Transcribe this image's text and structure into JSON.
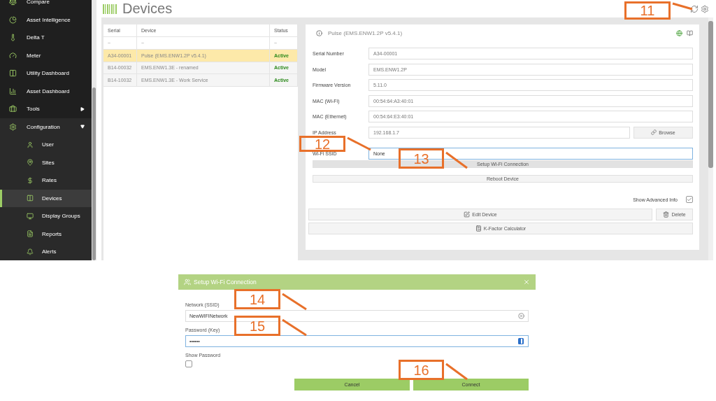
{
  "sidebar": {
    "items": [
      {
        "label": "Compare",
        "selected": false
      },
      {
        "label": "Asset Intelligence",
        "selected": false
      },
      {
        "label": "Delta T",
        "selected": false
      },
      {
        "label": "Meter",
        "selected": false
      },
      {
        "label": "Utility Dashboard",
        "selected": false
      },
      {
        "label": "Asset Dashboard",
        "selected": false
      },
      {
        "label": "Tools",
        "selected": false,
        "expanded": false
      },
      {
        "label": "Configuration",
        "selected": false,
        "expanded": true,
        "children": [
          {
            "label": "User",
            "selected": false
          },
          {
            "label": "Sites",
            "selected": false
          },
          {
            "label": "Rates",
            "selected": false
          },
          {
            "label": "Devices",
            "selected": true
          },
          {
            "label": "Display Groups",
            "selected": false
          },
          {
            "label": "Reports",
            "selected": false
          },
          {
            "label": "Alerts",
            "selected": false
          }
        ]
      }
    ]
  },
  "page": {
    "title": "Devices"
  },
  "table": {
    "columns": [
      "Serial",
      "Device",
      "Status"
    ],
    "filters": [
      "~",
      "~",
      "~"
    ],
    "rows": [
      {
        "serial": "A34-00001",
        "device": "Pulse (EMS.ENW1.2P v5.4.1)",
        "status": "Active",
        "selected": true
      },
      {
        "serial": "B14-00032",
        "device": "EMS.ENW1.3E - renamed",
        "status": "Active",
        "selected": false
      },
      {
        "serial": "B14-10032",
        "device": "EMS.ENW1.3E - Work Service",
        "status": "Active",
        "selected": false
      }
    ]
  },
  "detail": {
    "title": "Pulse (EMS.ENW1.2P v5.4.1)",
    "fields": [
      {
        "label": "Serial Number",
        "value": "A34-00001"
      },
      {
        "label": "Model",
        "value": "EMS.ENW1.2P"
      },
      {
        "label": "Firmware Version",
        "value": "5.11.0"
      },
      {
        "label": "MAC (Wi-Fi)",
        "value": "00:54:64:A3:40:01"
      },
      {
        "label": "MAC (Ethernet)",
        "value": "00:54:64:E3:40:01"
      },
      {
        "label": "IP Address",
        "value": "192.168.1.7",
        "button": "Browse"
      },
      {
        "label": "Wi-Fi SSID",
        "value": "None",
        "focused": true
      }
    ],
    "setup_button": "Setup Wi-Fi Connection",
    "reboot_button": "Reboot Device",
    "advanced": {
      "label": "Show Advanced Info",
      "checked": true
    },
    "edit_button": "Edit Device",
    "delete_button": "Delete",
    "kfactor_button": "K-Factor Calculator"
  },
  "dialog": {
    "title": "Setup Wi-Fi Connection",
    "network": {
      "label": "Network (SSID)",
      "value": "NewWIFINetwork"
    },
    "password": {
      "label": "Password (Key)",
      "value": "••••••"
    },
    "show_password": {
      "label": "Show Password",
      "checked": false
    },
    "buttons": [
      "Cancel",
      "Connect"
    ]
  },
  "annotations": [
    "11",
    "12",
    "13",
    "14",
    "15",
    "16"
  ]
}
